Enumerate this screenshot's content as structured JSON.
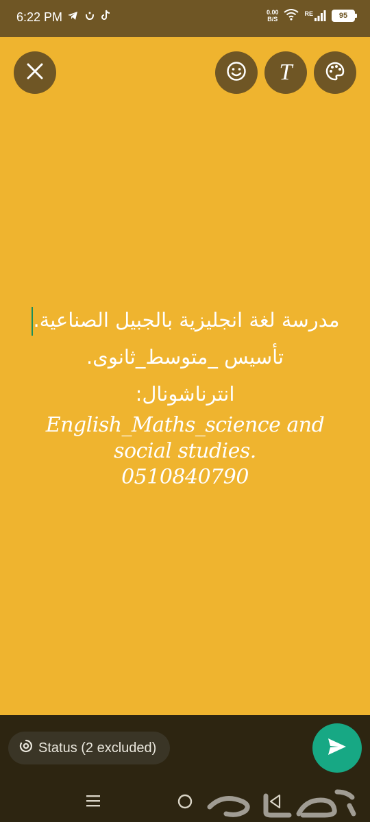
{
  "status_bar": {
    "time": "6:22 PM",
    "net_speed_value": "0.00",
    "net_speed_unit": "B/S",
    "signal_label": "RE",
    "battery": "95",
    "app_icons": [
      "telegram-icon",
      "nun-app-icon",
      "tiktok-icon"
    ]
  },
  "toolbar": {
    "close_icon": "close-icon",
    "emoji_icon": "emoji-icon",
    "text_icon": "text-format-icon",
    "text_glyph": "T",
    "palette_icon": "palette-icon"
  },
  "status_text": {
    "lines_ar": [
      "مدرسة لغة انجليزية بالجبيل الصناعية.",
      "تأسيس _متوسط_ثانوى.",
      "انترناشونال:"
    ],
    "lines_en": [
      "English_Maths_science and",
      "social studies.",
      "0510840790"
    ]
  },
  "bottom_bar": {
    "audience_label": "Status (2 excluded)",
    "send_icon": "send-icon"
  },
  "nav_bar": {
    "items": [
      "menu-icon",
      "home-icon",
      "back-icon"
    ]
  },
  "watermark": {
    "text": "حراج"
  },
  "colors": {
    "background": "#efb42f",
    "bars": "#6f5625",
    "bottom": "#2d2511",
    "send": "#17a884",
    "caret": "#1b8e5b"
  }
}
